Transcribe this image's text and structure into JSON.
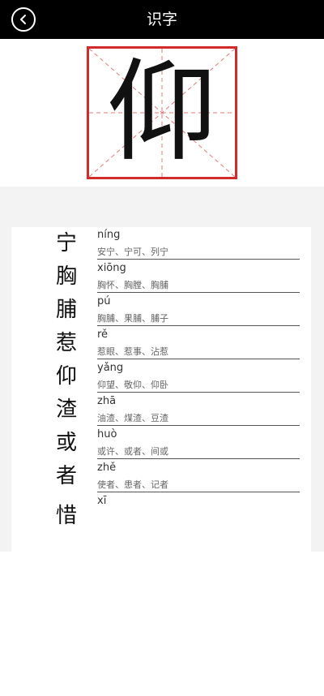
{
  "header": {
    "title": "识字"
  },
  "hero": {
    "character": "仰",
    "grid_color": "#d12b2b"
  },
  "list": {
    "items": [
      {
        "char": "宁",
        "pinyin": "níng",
        "words": "安宁、宁可、列宁"
      },
      {
        "char": "胸",
        "pinyin": "xiōng",
        "words": "胸怀、胸膛、胸脯"
      },
      {
        "char": "脯",
        "pinyin": "pú",
        "words": "胸脯、果脯、脯子"
      },
      {
        "char": "惹",
        "pinyin": "rě",
        "words": "惹眼、惹事、沾惹"
      },
      {
        "char": "仰",
        "pinyin": "yǎng",
        "words": "仰望、敬仰、仰卧"
      },
      {
        "char": "渣",
        "pinyin": "zhā",
        "words": "油渣、煤渣、豆渣"
      },
      {
        "char": "或",
        "pinyin": "huò",
        "words": "或许、或者、间或"
      },
      {
        "char": "者",
        "pinyin": "zhě",
        "words": "使者、患者、记者"
      },
      {
        "char": "惜",
        "pinyin": "xī",
        "words": ""
      }
    ]
  }
}
